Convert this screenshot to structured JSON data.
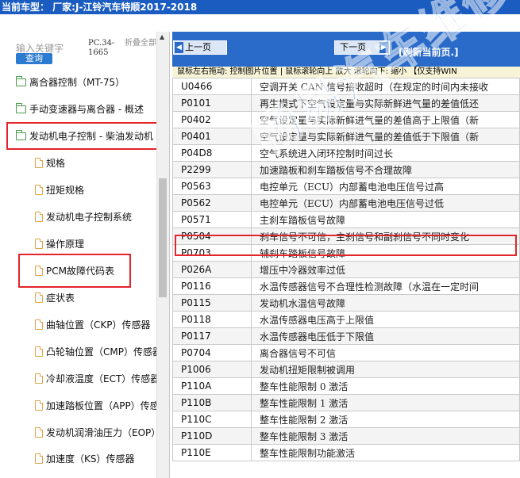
{
  "header": {
    "title": "当前车型：  厂家:J-江铃汽车特顺2017-2018"
  },
  "search": {
    "hint": "输入关键字",
    "query_button": "查询",
    "code": "PC.34-1665",
    "fold_all": "折叠全部"
  },
  "tree": [
    {
      "label": "离合器控制（MT-75）",
      "type": "folder"
    },
    {
      "label": "手动变速器与离合器 - 概述",
      "type": "folder"
    },
    {
      "label": "发动机电子控制 - 柴油发动机",
      "type": "folder-open"
    },
    {
      "label": "规格",
      "type": "doc"
    },
    {
      "label": "扭矩规格",
      "type": "doc"
    },
    {
      "label": "发动机电子控制系统",
      "type": "doc"
    },
    {
      "label": "操作原理",
      "type": "doc"
    },
    {
      "label": "PCM故障代码表",
      "type": "doc"
    },
    {
      "label": "症状表",
      "type": "doc"
    },
    {
      "label": "曲轴位置（CKP）传感器",
      "type": "doc"
    },
    {
      "label": "凸轮轴位置（CMP）传感器",
      "type": "doc"
    },
    {
      "label": "冷却液温度（ECT）传感器",
      "type": "doc"
    },
    {
      "label": "加速踏板位置（APP）传感器",
      "type": "doc"
    },
    {
      "label": "发动机润滑油压力（EOP）",
      "type": "doc"
    },
    {
      "label": "加速度（KS）传感器",
      "type": "doc"
    }
  ],
  "nav": {
    "prev": "上一页",
    "next": "下一页",
    "refresh": "[刷新当前页.]"
  },
  "tip": "鼠标左右拖动: 控制图片位置 | 鼠标滚轮向上 放大  滚轮向下: 缩小 【仅支持WIN",
  "codes": [
    {
      "code": "U0466",
      "desc": "空调开关 CAN 信号接收超时（在规定的时间内未接收"
    },
    {
      "code": "P0101",
      "desc": "再生模式下空气设定量与实际新鲜进气量的差值低还"
    },
    {
      "code": "P0402",
      "desc": "空气设定量与实际新鲜进气量的差值高于上限值（新"
    },
    {
      "code": "P0401",
      "desc": "空气设定量与实际新鲜进气量的差值低于下限值（新"
    },
    {
      "code": "P04D8",
      "desc": "空气系统进入闭环控制时间过长"
    },
    {
      "code": "P2299",
      "desc": "加速踏板和刹车踏板信号不合理故障"
    },
    {
      "code": "P0563",
      "desc": "电控单元（ECU）内部蓄电池电压信号过高"
    },
    {
      "code": "P0562",
      "desc": "电控单元（ECU）内部蓄电池电压信号过低"
    },
    {
      "code": "P0571",
      "desc": "主刹车踏板信号故障"
    },
    {
      "code": "P0504",
      "desc": "刹车信号不可信，主刹信号和副刹信号不同时变化"
    },
    {
      "code": "P0703",
      "desc": "辅刹车踏板信号故障"
    },
    {
      "code": "P026A",
      "desc": "增压中冷器效率过低"
    },
    {
      "code": "P0116",
      "desc": "水温传感器信号不合理性检测故障（水温在一定时间"
    },
    {
      "code": "P0115",
      "desc": "发动机水温信号故障"
    },
    {
      "code": "P0118",
      "desc": "水温传感器电压高于上限值"
    },
    {
      "code": "P0117",
      "desc": "水温传感器电压低于下限值"
    },
    {
      "code": "P0704",
      "desc": "离合器信号不可信"
    },
    {
      "code": "P1006",
      "desc": "发动机扭矩限制被调用"
    },
    {
      "code": "P110A",
      "desc": "整车性能限制 0 激活"
    },
    {
      "code": "P110B",
      "desc": "整车性能限制 1 激活"
    },
    {
      "code": "P110C",
      "desc": "整车性能限制 2 激活"
    },
    {
      "code": "P110D",
      "desc": "整车性能限制 3 激活"
    },
    {
      "code": "P110E",
      "desc": "整车性能限制功能激活"
    }
  ],
  "watermark": "畅易汽车维修网",
  "colors": {
    "header_bg": "#1a5cc0",
    "nav_bg": "#2a6ac8",
    "highlight": "#e3242b",
    "watermark": "#2c7bd3"
  }
}
